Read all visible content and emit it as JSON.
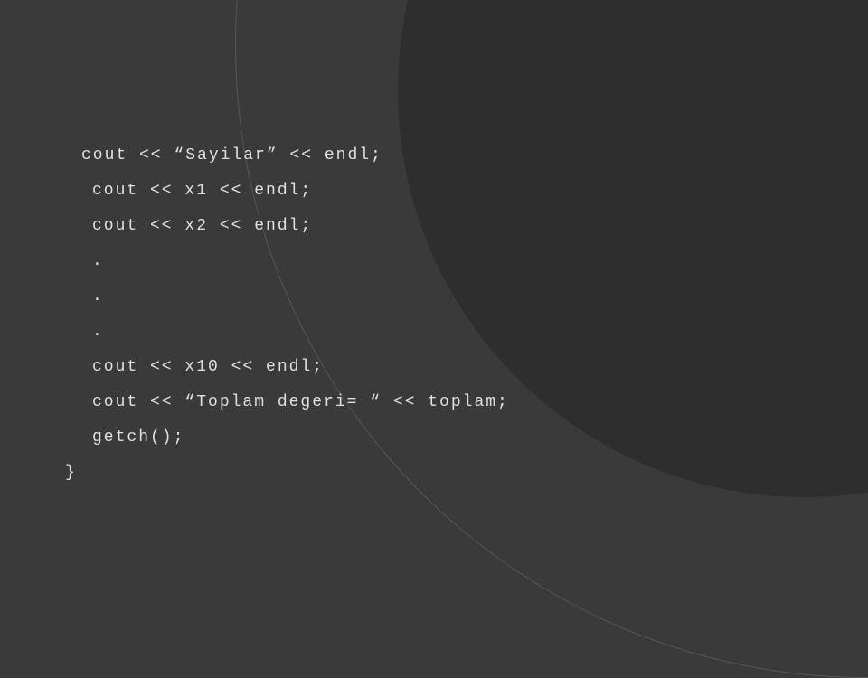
{
  "code": {
    "line1": "cout << “Sayilar” << endl;",
    "line2": "cout << x1 << endl;",
    "line3": "cout << x2 << endl;",
    "line4": ".",
    "line5": ".",
    "line6": ".",
    "line7": "cout << x10 << endl;",
    "line8": "",
    "line9": "cout << “Toplam degeri= “ << toplam;",
    "line10": "",
    "line11": "getch();",
    "line12": "}"
  }
}
